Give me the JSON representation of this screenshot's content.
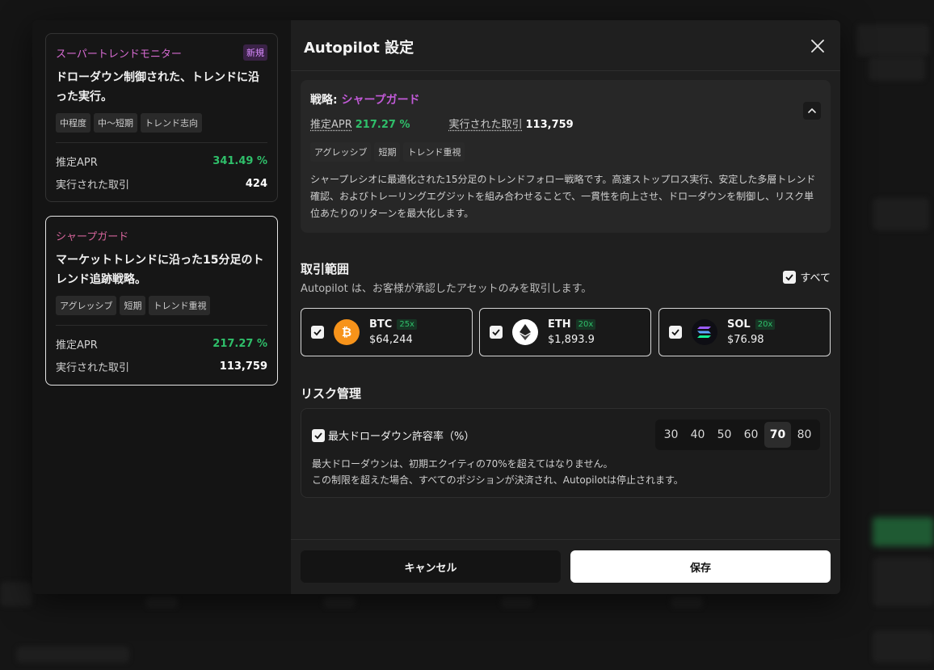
{
  "colors": {
    "accent_green": "#2fbf6a",
    "accent_purple": "#c25ad8",
    "btc": "#f7931a",
    "eth_bg": "#ffffff",
    "sol_bg": "#0e0e14"
  },
  "strategies": [
    {
      "name": "スーパートレンドモニター",
      "badge": "新規",
      "desc": "ドローダウン制御された、トレンドに沿った実行。",
      "tags": [
        "中程度",
        "中〜短期",
        "トレンド志向"
      ],
      "apr_label": "推定APR",
      "apr": "341.49 %",
      "trades_label": "実行された取引",
      "trades": "424"
    },
    {
      "name": "シャープガード",
      "desc": "マーケットトレンドに沿った15分足のトレンド追跡戦略。",
      "tags": [
        "アグレッシブ",
        "短期",
        "トレンド重視"
      ],
      "apr_label": "推定APR",
      "apr": "217.27 %",
      "trades_label": "実行された取引",
      "trades": "113,759"
    }
  ],
  "modal": {
    "title": "Autopilot 設定",
    "close_icon": "close-icon"
  },
  "detail": {
    "title_prefix": "戦略: ",
    "name": "シャープガード",
    "apr_label": "推定APR",
    "apr": "217.27 %",
    "trades_label": "実行された取引",
    "trades": "113,759",
    "tags": [
      "アグレッシブ",
      "短期",
      "トレンド重視"
    ],
    "body": "シャープレシオに最適化された15分足のトレンドフォロー戦略です。高速ストップロス実行、安定した多層トレンド確認、およびトレーリングエグジットを組み合わせることで、一貫性を向上させ、ドローダウンを制御し、リスク単位あたりのリターンを最大化します。"
  },
  "trading_scope": {
    "title": "取引範囲",
    "subtitle": "Autopilot は、お客様が承認したアセットのみを取引します。",
    "all_label": "すべて",
    "assets": [
      {
        "symbol": "BTC",
        "leverage": "25x",
        "price": "$64,244",
        "icon": "bitcoin-icon"
      },
      {
        "symbol": "ETH",
        "leverage": "20x",
        "price": "$1,893.9",
        "icon": "ethereum-icon"
      },
      {
        "symbol": "SOL",
        "leverage": "20x",
        "price": "$76.98",
        "icon": "solana-icon"
      }
    ]
  },
  "risk": {
    "title": "リスク管理",
    "drawdown_label": "最大ドローダウン許容率（%）",
    "options": [
      "30",
      "40",
      "50",
      "60",
      "70",
      "80"
    ],
    "selected": "70",
    "note_line1": "最大ドローダウンは、初期エクイティの70%を超えてはなりません。",
    "note_line2": "この制限を超えた場合、すべてのポジションが決済され、Autopilotは停止されます。"
  },
  "footer": {
    "cancel_label": "キャンセル",
    "save_label": "保存"
  }
}
